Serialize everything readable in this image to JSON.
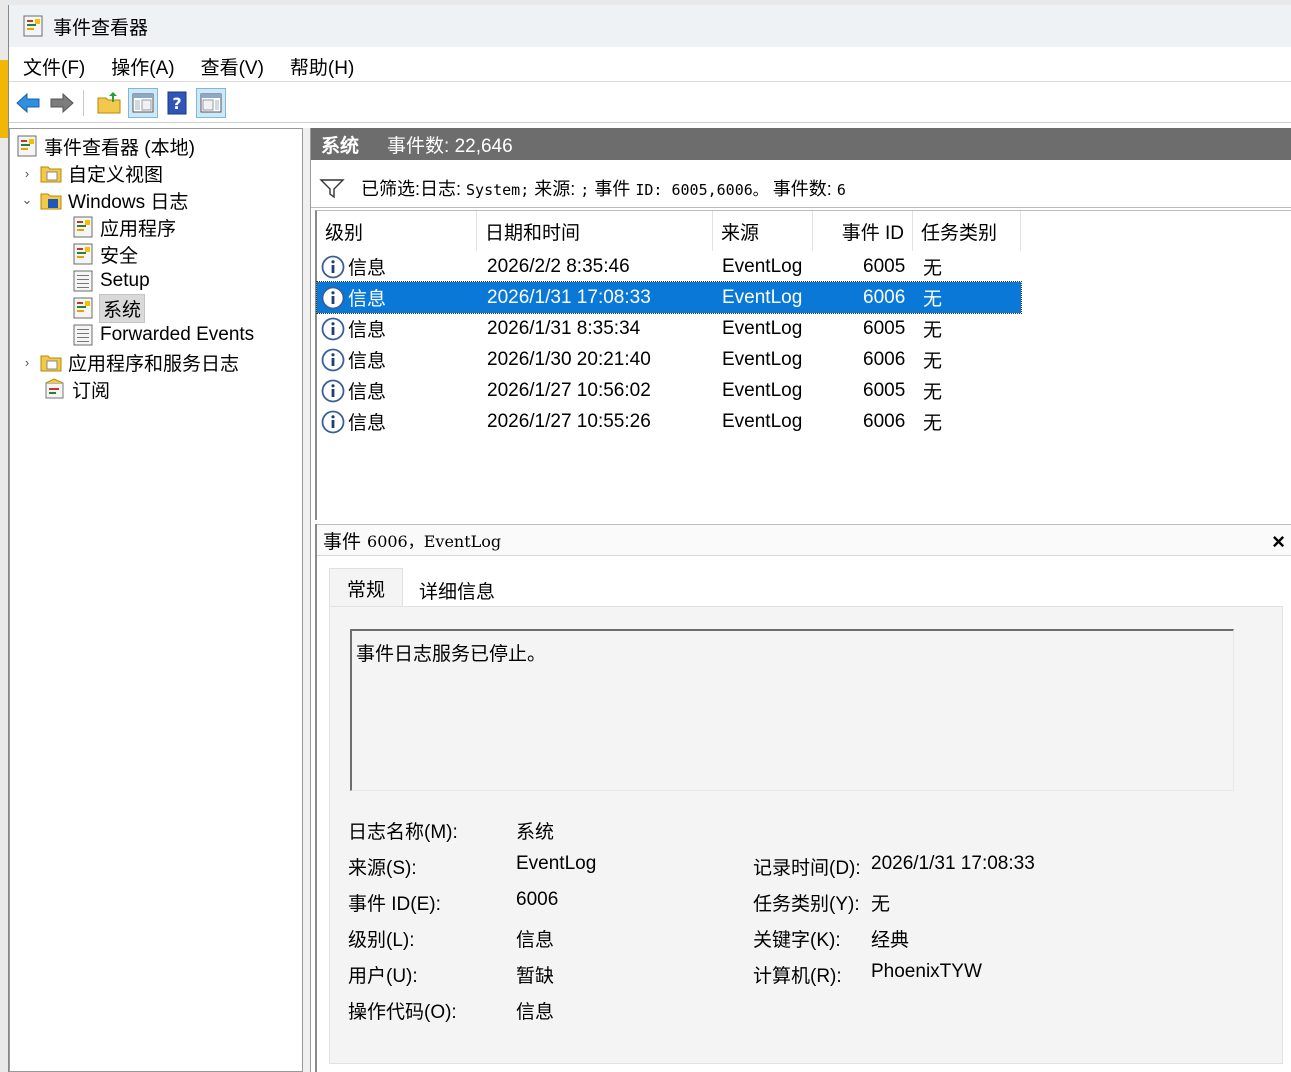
{
  "window": {
    "title": "事件查看器"
  },
  "menu": [
    {
      "label": "文件(F)"
    },
    {
      "label": "操作(A)"
    },
    {
      "label": "查看(V)"
    },
    {
      "label": "帮助(H)"
    }
  ],
  "toolbar": {
    "icons": [
      "back-arrow-icon",
      "forward-arrow-icon",
      "up-folder-icon",
      "show-hide-tree-icon",
      "help-icon",
      "show-hide-action-pane-icon"
    ]
  },
  "tree": {
    "root": "事件查看器 (本地)",
    "custom_views": "自定义视图",
    "windows_logs": "Windows 日志",
    "application": "应用程序",
    "security": "安全",
    "setup": "Setup",
    "system": "系统",
    "forwarded": "Forwarded Events",
    "app_service_logs": "应用程序和服务日志",
    "subscriptions": "订阅"
  },
  "header": {
    "log_name": "系统",
    "count_label": "事件数: 22,646"
  },
  "filter": {
    "prefix": "已筛选:日志:",
    "log": "System;",
    "source_label": "来源:",
    "source_value": ";",
    "id_label": "事件",
    "id_value": "ID: 6005,6006。",
    "count_label": "事件数:",
    "count_value": "6"
  },
  "columns": [
    "级别",
    "日期和时间",
    "来源",
    "事件 ID",
    "任务类别"
  ],
  "events": [
    {
      "level": "信息",
      "datetime": "2026/2/2 8:35:46",
      "source": "EventLog",
      "id": "6005",
      "task": "无"
    },
    {
      "level": "信息",
      "datetime": "2026/1/31 17:08:33",
      "source": "EventLog",
      "id": "6006",
      "task": "无"
    },
    {
      "level": "信息",
      "datetime": "2026/1/31 8:35:34",
      "source": "EventLog",
      "id": "6005",
      "task": "无"
    },
    {
      "level": "信息",
      "datetime": "2026/1/30 20:21:40",
      "source": "EventLog",
      "id": "6006",
      "task": "无"
    },
    {
      "level": "信息",
      "datetime": "2026/1/27 10:56:02",
      "source": "EventLog",
      "id": "6005",
      "task": "无"
    },
    {
      "level": "信息",
      "datetime": "2026/1/27 10:55:26",
      "source": "EventLog",
      "id": "6006",
      "task": "无"
    }
  ],
  "selected_row": 1,
  "detail": {
    "title_label": "事件",
    "title_value": "6006，EventLog",
    "close": "×",
    "tabs": [
      "常规",
      "详细信息"
    ],
    "description": "事件日志服务已停止。",
    "log_name_label": "日志名称(M):",
    "log_name_value": "系统",
    "source_label": "来源(S):",
    "source_value": "EventLog",
    "recorded_label": "记录时间(D):",
    "recorded_value": "2026/1/31 17:08:33",
    "event_id_label": "事件 ID(E):",
    "event_id_value": "6006",
    "task_label": "任务类别(Y):",
    "task_value": "无",
    "level_label": "级别(L):",
    "level_value": "信息",
    "keywords_label": "关键字(K):",
    "keywords_value": "经典",
    "user_label": "用户(U):",
    "user_value": "暂缺",
    "computer_label": "计算机(R):",
    "computer_value": "PhoenixTYW",
    "opcode_label": "操作代码(O):",
    "opcode_value": "信息"
  },
  "colors": {
    "selection": "#0a78d7",
    "header_bar": "#6d6d6d",
    "info_icon": "#1e5aa8"
  }
}
